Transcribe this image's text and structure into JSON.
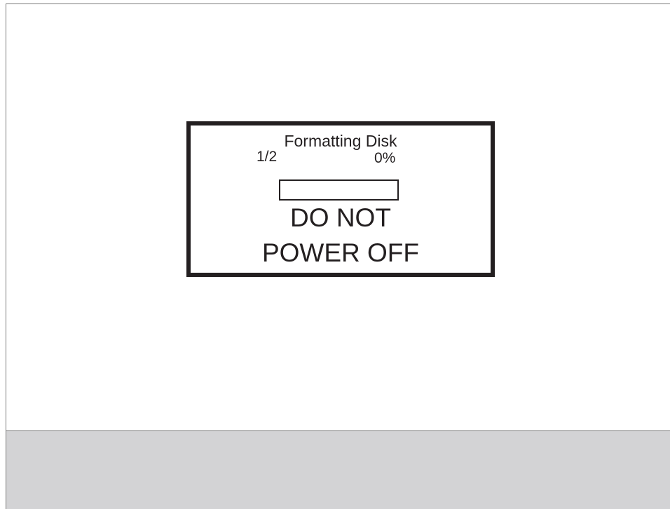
{
  "dialog": {
    "title": "Formatting Disk",
    "disk_count": "1/2",
    "percent_text": "0%",
    "progress_fraction": 0,
    "warning_line1": "DO NOT",
    "warning_line2": "POWER OFF"
  },
  "colors": {
    "ink": "#231f20",
    "panel_background": "#ffffff",
    "bottom_bar": "#d3d3d5",
    "frame_line": "#7a7a7a"
  }
}
